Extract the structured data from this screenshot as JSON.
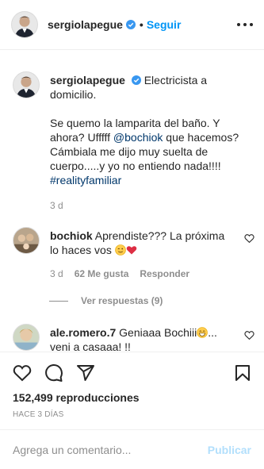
{
  "header": {
    "username": "sergiolapegue",
    "separator": "•",
    "follow_label": "Seguir"
  },
  "caption": {
    "username": "sergiolapegue",
    "line1": "Electricista a domicilio.",
    "line2_a": "Se quemo la lamparita del baño. Y ahora? Ufffff ",
    "mention": "@bochiok",
    "line2_b": " que hacemos? Cámbiala me dijo muy suelta de cuerpo.....y yo no entiendo nada!!!!",
    "hashtag": "#realityfamiliar",
    "time": "3 d"
  },
  "comments": [
    {
      "username": "bochiok",
      "text": "Aprendiste??? La próxima lo haces vos",
      "time": "3 d",
      "likes": "62 Me gusta",
      "reply_label": "Responder",
      "view_replies": "Ver respuestas (9)"
    },
    {
      "username": "ale.romero.7",
      "text_a": "Geniaaa Bochiii",
      "text_b": "... veni a casaaa! !!"
    }
  ],
  "footer": {
    "views": "152,499 reproducciones",
    "ago": "HACE 3 DÍAS",
    "comment_placeholder": "Agrega un comentario...",
    "publish_label": "Publicar"
  },
  "icons": {
    "like": "heart-icon",
    "comment": "comment-icon",
    "share": "share-icon",
    "save": "bookmark-icon",
    "more": "more-options-icon",
    "verified": "verified-badge-icon"
  },
  "colors": {
    "link_blue": "#0095f6",
    "mention_blue": "#00376b",
    "verified_blue": "#3897f0",
    "muted": "#8e8e8e",
    "publish_disabled": "#b2dffc"
  }
}
